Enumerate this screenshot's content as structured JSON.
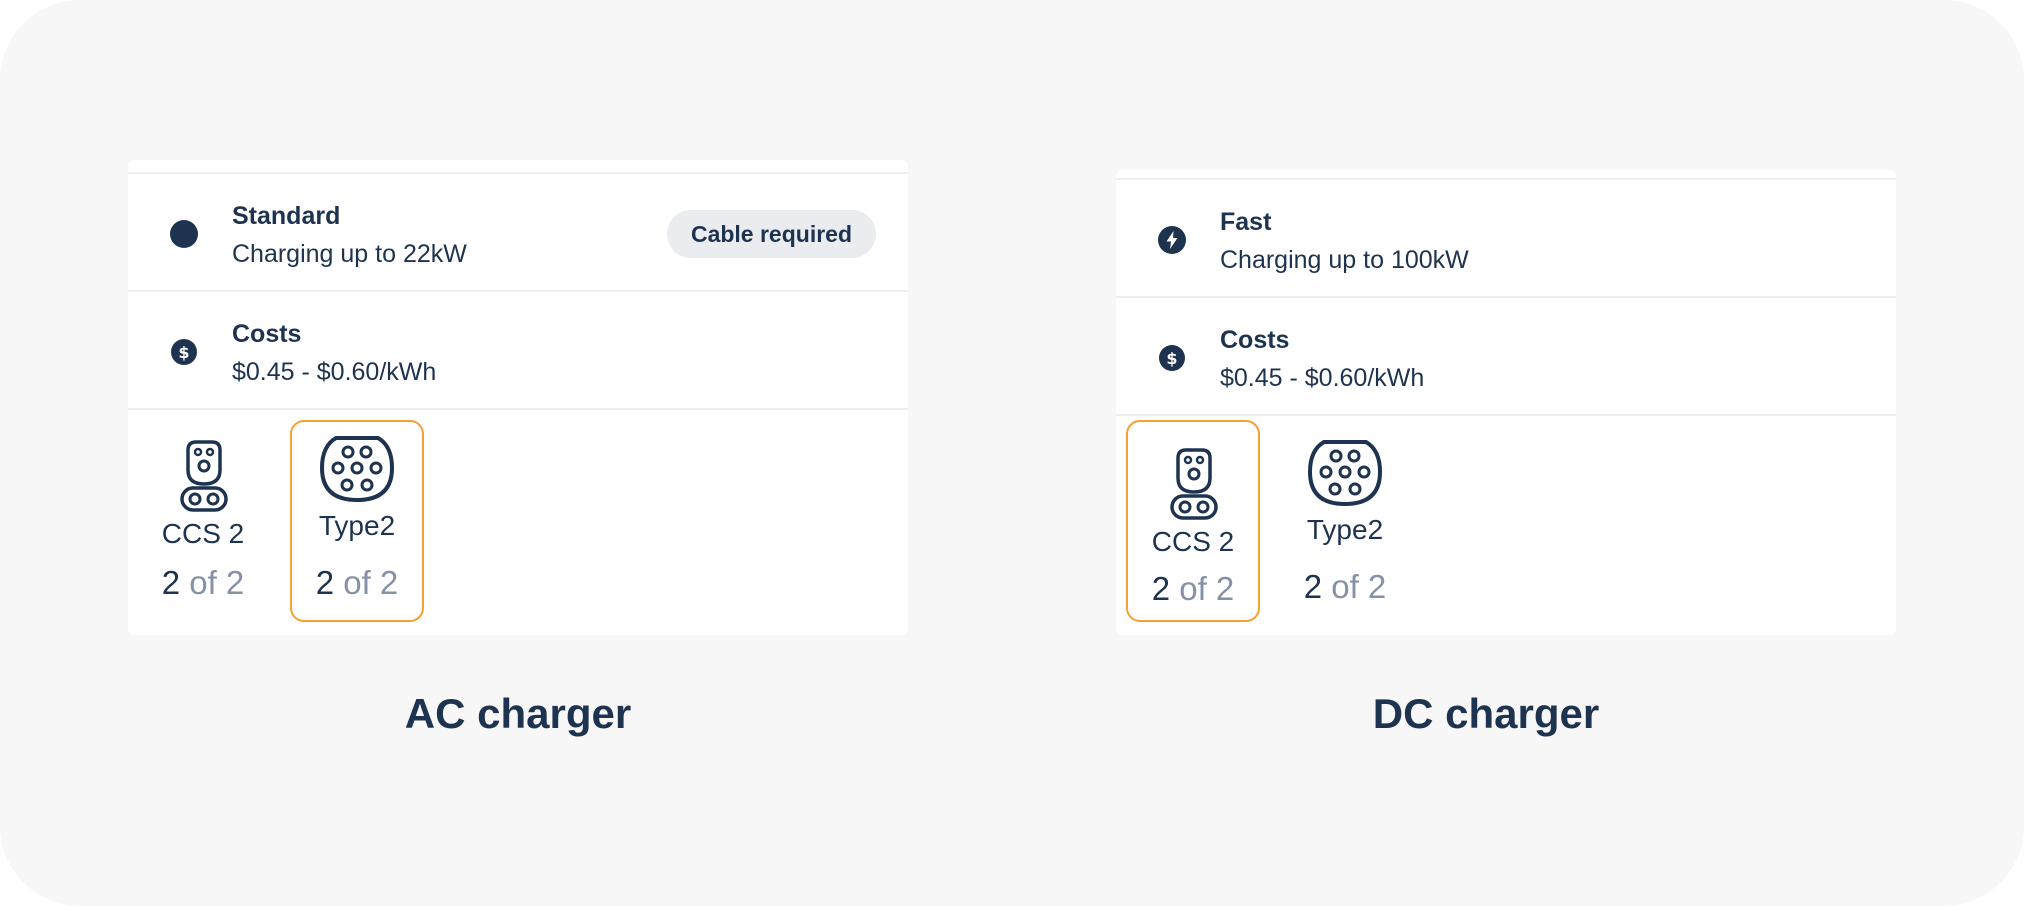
{
  "ac": {
    "charge": {
      "title": "Standard",
      "sub": "Charging up to 22kW",
      "badge": "Cable required"
    },
    "costs": {
      "title": "Costs",
      "sub": "$0.45 - $0.60/kWh"
    },
    "connectors": [
      {
        "name": "CCS 2",
        "available": "2",
        "of": "of 2",
        "icon": "ccs2-plug-icon",
        "selected": false
      },
      {
        "name": "Type2",
        "available": "2",
        "of": "of 2",
        "icon": "type2-plug-icon",
        "selected": true
      }
    ],
    "label": "AC charger"
  },
  "dc": {
    "charge": {
      "title": "Fast",
      "sub": "Charging up to 100kW"
    },
    "costs": {
      "title": "Costs",
      "sub": "$0.45 - $0.60/kWh"
    },
    "connectors": [
      {
        "name": "CCS 2",
        "available": "2",
        "of": "of 2",
        "icon": "ccs2-plug-icon",
        "selected": true
      },
      {
        "name": "Type2",
        "available": "2",
        "of": "of 2",
        "icon": "type2-plug-icon",
        "selected": false
      }
    ],
    "label": "DC charger"
  },
  "colors": {
    "text": "#1e3350",
    "muted": "#8592a6",
    "selected_border": "#f5a033",
    "badge_bg": "#eaecf0",
    "background": "#f7f7f7"
  }
}
